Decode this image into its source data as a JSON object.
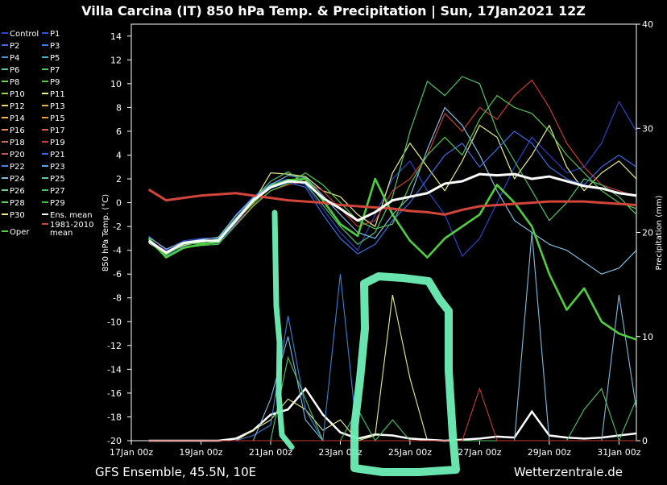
{
  "title": "Villa Carcina  (IT)  850 hPa Temp. & Precipitation | Sun, 17Jan2021 12Z",
  "footer_left": "GFS Ensemble, 45.5N, 10E",
  "footer_right": "Wetterzentrale.de",
  "legend": [
    {
      "label": "Control",
      "color": "#2b44c8"
    },
    {
      "label": "P1",
      "color": "#3a52d6"
    },
    {
      "label": "P2",
      "color": "#3c6be0"
    },
    {
      "label": "P3",
      "color": "#3b7fd6"
    },
    {
      "label": "P4",
      "color": "#4d8fd8"
    },
    {
      "label": "P5",
      "color": "#4ab2c8"
    },
    {
      "label": "P6",
      "color": "#5cc7a8"
    },
    {
      "label": "P7",
      "color": "#4fc46a"
    },
    {
      "label": "P8",
      "color": "#6fcf5a"
    },
    {
      "label": "P9",
      "color": "#55c84d"
    },
    {
      "label": "P10",
      "color": "#8fd94e"
    },
    {
      "label": "P11",
      "color": "#e8ef8a"
    },
    {
      "label": "P12",
      "color": "#f0d56a"
    },
    {
      "label": "P13",
      "color": "#e3b84c"
    },
    {
      "label": "P14",
      "color": "#f1b455"
    },
    {
      "label": "P15",
      "color": "#ea9a3d"
    },
    {
      "label": "P16",
      "color": "#ec8a49"
    },
    {
      "label": "P17",
      "color": "#d9623a"
    },
    {
      "label": "P18",
      "color": "#c86a55"
    },
    {
      "label": "P19",
      "color": "#c83c32"
    },
    {
      "label": "P20",
      "color": "#c25a54"
    },
    {
      "label": "P21",
      "color": "#3f63d8"
    },
    {
      "label": "P22",
      "color": "#4f7fe0"
    },
    {
      "label": "P23",
      "color": "#5aa5e3"
    },
    {
      "label": "P24",
      "color": "#7fbce0"
    },
    {
      "label": "P25",
      "color": "#62c6ae"
    },
    {
      "label": "P26",
      "color": "#76cf8c"
    },
    {
      "label": "P27",
      "color": "#4cbf63"
    },
    {
      "label": "P28",
      "color": "#6bd05a"
    },
    {
      "label": "P29",
      "color": "#3cc03a"
    },
    {
      "label": "P30",
      "color": "#f3ea8a"
    },
    {
      "label": "Ens. mean",
      "color": "#ffffff"
    },
    {
      "label": "Oper",
      "color": "#4fcf3f"
    },
    {
      "label": "1981-2010 mean",
      "color": "#d3453a"
    }
  ],
  "chart_data": {
    "type": "line",
    "title": "Villa Carcina  (IT)  850 hPa Temp. & Precipitation | Sun, 17Jan2021 12Z",
    "xlabel": "",
    "ylabel": "850 hPa Temp. (°C)",
    "y2label": "Precipitation (mm)",
    "x_ticks": [
      "17Jan 00z",
      "19Jan 00z",
      "21Jan 00z",
      "23Jan 00z",
      "25Jan 00z",
      "27Jan 00z",
      "29Jan 00z",
      "31Jan 00z"
    ],
    "y_ticks": [
      14,
      12,
      10,
      8,
      6,
      4,
      2,
      0,
      -2,
      -4,
      -6,
      -8,
      -10,
      -12,
      -14,
      -16,
      -18,
      -20
    ],
    "y2_ticks": [
      40,
      30,
      20,
      10,
      0
    ],
    "ylim": [
      -20,
      15
    ],
    "y2lim": [
      0,
      40
    ],
    "xlim_days": [
      0,
      14.5
    ],
    "grid": false,
    "x_days": [
      0.5,
      1,
      1.5,
      2,
      2.5,
      3,
      3.5,
      4,
      4.5,
      5,
      5.5,
      6,
      6.5,
      7,
      7.5,
      8,
      8.5,
      9,
      9.5,
      10,
      10.5,
      11,
      11.5,
      12,
      12.5,
      13,
      13.5,
      14,
      14.5
    ],
    "series": [
      {
        "name": "Ens. mean",
        "color": "#ffffff",
        "values": [
          -3.2,
          -4.2,
          -3.4,
          -3.2,
          -3.2,
          -1.5,
          0.2,
          1.3,
          1.8,
          1.7,
          0.4,
          -0.5,
          -1.5,
          -0.8,
          0.2,
          0.5,
          0.8,
          1.6,
          1.8,
          2.4,
          2.3,
          2.4,
          2.0,
          2.2,
          1.8,
          1.4,
          1.2,
          0.8,
          0.6
        ]
      },
      {
        "name": "1981-2010 mean",
        "color": "#d3453a",
        "values": [
          1.1,
          0.2,
          0.4,
          0.6,
          0.7,
          0.8,
          0.6,
          0.4,
          0.2,
          0.1,
          0.0,
          -0.2,
          -0.3,
          -0.4,
          -0.5,
          -0.7,
          -0.8,
          -1.0,
          -0.6,
          -0.3,
          -0.2,
          -0.1,
          0.0,
          0.1,
          0.1,
          0.1,
          0.0,
          -0.1,
          -0.2
        ]
      },
      {
        "name": "Oper",
        "color": "#4fcf3f",
        "values": [
          -3.0,
          -4.6,
          -3.8,
          -3.5,
          -3.3,
          -1.4,
          0.0,
          1.4,
          1.9,
          2.0,
          0.2,
          -1.8,
          -2.8,
          2.0,
          -1.0,
          -3.2,
          -4.6,
          -3.0,
          -2.0,
          -1.0,
          1.5,
          0.0,
          -2.0,
          -6.0,
          -9.0,
          -7.2,
          -10.0,
          -11.0,
          -11.5
        ]
      },
      {
        "name": "Control",
        "color": "#2b44c8",
        "values": [
          -2.8,
          -4.0,
          -3.2,
          -3.0,
          -3.0,
          -1.0,
          0.5,
          1.6,
          2.0,
          1.5,
          -0.5,
          -2.5,
          -4.0,
          -1.0,
          2.0,
          3.5,
          1.0,
          -1.0,
          -4.5,
          -3.0,
          0.0,
          3.0,
          5.5,
          4.0,
          2.5,
          3.0,
          5.0,
          8.5,
          6.0
        ]
      },
      {
        "name": "P11",
        "color": "#e8ef8a",
        "values": [
          -3.4,
          -4.3,
          -3.6,
          -3.3,
          -3.1,
          -1.6,
          0.0,
          2.5,
          2.4,
          2.2,
          1.0,
          0.5,
          -1.0,
          -2.0,
          2.5,
          5.0,
          3.0,
          1.0,
          3.5,
          6.5,
          5.5,
          2.0,
          4.0,
          6.5,
          3.0,
          1.0,
          2.5,
          3.5,
          2.0
        ]
      },
      {
        "name": "P19",
        "color": "#c83c32",
        "values": [
          -3.1,
          -4.1,
          -3.4,
          -3.2,
          -3.3,
          -1.8,
          -0.2,
          1.0,
          1.5,
          1.8,
          1.0,
          -0.5,
          -2.0,
          -1.5,
          1.0,
          2.0,
          4.0,
          7.5,
          6.0,
          8.0,
          7.0,
          9.0,
          10.3,
          8.0,
          5.0,
          3.0,
          1.5,
          1.0,
          0.5
        ]
      },
      {
        "name": "P7",
        "color": "#4fc46a",
        "values": [
          -3.0,
          -4.4,
          -3.5,
          -3.4,
          -3.0,
          -1.3,
          0.3,
          1.8,
          2.6,
          1.6,
          -0.2,
          -2.0,
          -3.5,
          -2.5,
          0.5,
          6.0,
          10.2,
          9.0,
          10.6,
          10.0,
          6.0,
          3.5,
          1.0,
          -1.5,
          0.0,
          2.0,
          1.5,
          0.5,
          -1.0
        ]
      },
      {
        "name": "P24",
        "color": "#7fbce0",
        "values": [
          -2.9,
          -3.9,
          -3.3,
          -3.1,
          -2.9,
          -1.1,
          0.4,
          1.5,
          2.3,
          2.1,
          0.6,
          -1.0,
          -2.5,
          -3.0,
          -1.0,
          0.5,
          4.5,
          8.0,
          6.5,
          4.0,
          1.0,
          -1.5,
          -2.5,
          -3.5,
          -4.0,
          -5.0,
          -6.0,
          -5.5,
          -4.0
        ]
      },
      {
        "name": "P2",
        "color": "#3c6be0",
        "values": [
          -3.3,
          -4.5,
          -3.7,
          -3.5,
          -3.4,
          -1.7,
          0.1,
          1.2,
          1.7,
          1.3,
          -1.0,
          -3.0,
          -4.3,
          -3.5,
          -1.5,
          0.0,
          2.0,
          4.0,
          5.0,
          3.0,
          4.5,
          6.0,
          5.0,
          3.0,
          2.0,
          1.5,
          3.0,
          4.0,
          3.0
        ]
      },
      {
        "name": "P9",
        "color": "#55c84d",
        "values": [
          -3.2,
          -4.6,
          -3.8,
          -3.6,
          -3.5,
          -1.9,
          -0.3,
          1.0,
          1.6,
          2.5,
          1.5,
          0.0,
          -1.5,
          -2.2,
          -1.8,
          1.5,
          4.0,
          5.5,
          4.0,
          7.0,
          9.0,
          8.0,
          7.5,
          6.0,
          4.0,
          2.5,
          1.0,
          0.0,
          -0.5
        ]
      }
    ],
    "precip_series": [
      {
        "name": "Ens. mean",
        "color": "#ffffff",
        "values": [
          0.0,
          0.0,
          0.0,
          0.0,
          0.0,
          0.2,
          1.0,
          2.5,
          3.0,
          5.0,
          2.5,
          0.8,
          0.2,
          0.6,
          0.5,
          0.2,
          0.1,
          0.0,
          0.1,
          0.2,
          0.4,
          0.3,
          2.8,
          0.5,
          0.3,
          0.2,
          0.3,
          0.5,
          0.7
        ]
      },
      {
        "name": "P11",
        "color": "#e8ef8a",
        "values": [
          0.0,
          0.0,
          0.0,
          0.0,
          0.0,
          0.0,
          1.0,
          2.0,
          4.0,
          3.0,
          1.0,
          2.0,
          0.0,
          0.5,
          14.0,
          6.0,
          0.0,
          0.0,
          0.0,
          0.0,
          0.0,
          0.0,
          0.0,
          0.0,
          0.0,
          0.0,
          0.0,
          0.0,
          0.0
        ]
      },
      {
        "name": "P3",
        "color": "#3b7fd6",
        "values": [
          0.0,
          0.0,
          0.0,
          0.0,
          0.0,
          0.0,
          0.5,
          1.5,
          12.0,
          3.0,
          0.0,
          16.0,
          0.0,
          0.0,
          0.0,
          0.0,
          0.0,
          0.0,
          0.0,
          0.0,
          0.0,
          0.0,
          0.0,
          0.0,
          0.0,
          0.0,
          0.0,
          0.0,
          0.0
        ]
      },
      {
        "name": "P24",
        "color": "#7fbce0",
        "values": [
          0.0,
          0.0,
          0.0,
          0.0,
          0.0,
          0.0,
          0.0,
          4.0,
          10.0,
          2.0,
          0.0,
          0.0,
          0.0,
          0.0,
          0.0,
          0.0,
          0.0,
          0.0,
          0.0,
          0.0,
          0.0,
          0.0,
          20.0,
          0.0,
          0.0,
          0.0,
          0.0,
          14.0,
          3.0
        ]
      },
      {
        "name": "P7",
        "color": "#4fc46a",
        "values": [
          0.0,
          0.0,
          0.0,
          0.0,
          0.0,
          0.0,
          0.0,
          0.0,
          8.0,
          4.0,
          0.0,
          0.0,
          3.0,
          0.0,
          2.0,
          0.0,
          0.0,
          0.0,
          0.0,
          0.0,
          0.0,
          0.0,
          0.0,
          0.0,
          0.0,
          3.0,
          5.0,
          0.0,
          4.0
        ]
      },
      {
        "name": "P19",
        "color": "#c83c32",
        "values": [
          0.0,
          0.0,
          0.0,
          0.0,
          0.0,
          0.0,
          0.0,
          0.0,
          0.0,
          0.0,
          0.0,
          0.0,
          0.0,
          0.0,
          0.0,
          0.0,
          0.0,
          0.0,
          0.0,
          5.0,
          0.0,
          0.0,
          0.0,
          0.0,
          0.0,
          0.0,
          0.0,
          0.0,
          0.0
        ]
      }
    ]
  }
}
